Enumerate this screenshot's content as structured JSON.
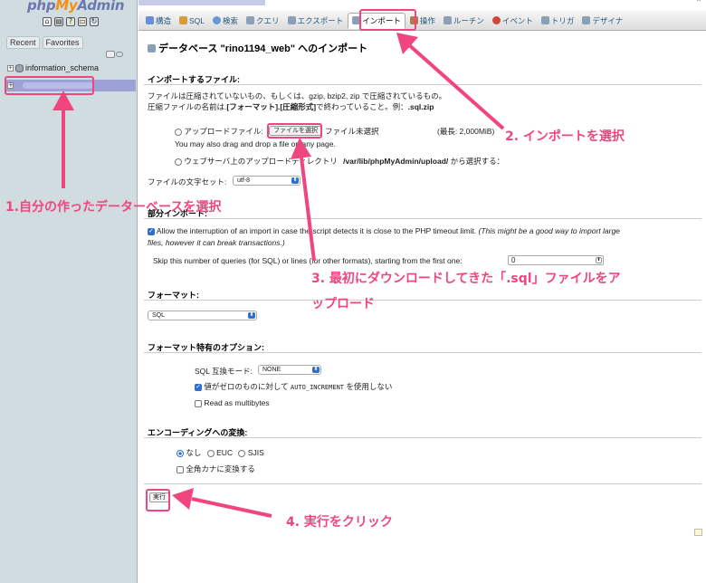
{
  "sidebar": {
    "logo": {
      "php": "php",
      "my": "My",
      "admin": "Admin"
    },
    "quick_icons": [
      "home-icon",
      "exit-icon",
      "docs-icon",
      "sql-window-icon",
      "reload-icon"
    ],
    "tabs": [
      "Recent",
      "Favorites"
    ],
    "tree": {
      "db1": "information_schema",
      "plus": "+"
    }
  },
  "tabs": [
    {
      "label": "構造",
      "icon": "table-icon",
      "color": "#6c8ed8"
    },
    {
      "label": "SQL",
      "icon": "sql-icon",
      "color": "#d89c3a"
    },
    {
      "label": "検索",
      "icon": "search-icon",
      "color": "#5f9ad6"
    },
    {
      "label": "クエリ",
      "icon": "query-icon",
      "color": "#8aa0b8"
    },
    {
      "label": "エクスポート",
      "icon": "export-icon",
      "color": "#8aa0b8"
    },
    {
      "label": "インポート",
      "icon": "import-icon",
      "color": "#8aa0b8"
    },
    {
      "label": "操作",
      "icon": "tools-icon",
      "color": "#b07a4a"
    },
    {
      "label": "ルーチン",
      "icon": "routine-icon",
      "color": "#8aa0b8"
    },
    {
      "label": "イベント",
      "icon": "clock-icon",
      "color": "#d0453a"
    },
    {
      "label": "トリガ",
      "icon": "trigger-icon",
      "color": "#8aa0b8"
    },
    {
      "label": "デザイナ",
      "icon": "designer-icon",
      "color": "#8aa0b8"
    }
  ],
  "main": {
    "title": "データベース \"rino1194_web\" へのインポート",
    "section_file": "インポートするファイル:",
    "compress_note1": "ファイルは圧縮されていないもの、もしくは、gzip, bzip2, zip で圧縮されているもの。",
    "compress_note2a": "圧縮ファイルの名前は.",
    "compress_note2b": "[フォーマット].[圧縮形式]",
    "compress_note2c": "で終わっていること。例：",
    "compress_note2d": ".sql.zip",
    "upload_label": "アップロードファイル:",
    "file_button": "ファイルを選択",
    "file_none": "ファイル未選択",
    "max_size": "(最長: 2,000MiB)",
    "drag_drop": "You may also drag and drop a file on any page.",
    "webserver_label": "ウェブサーバ上のアップロードディレクトリ",
    "webserver_path": "/var/lib/phpMyAdmin/upload/",
    "webserver_suffix": "から選択する：",
    "charset_label": "ファイルの文字セット:",
    "charset_value": "utf-8",
    "section_partial": "部分インポート:",
    "allow_interrupt_a": "Allow the interruption of an import in case the script detects it is close to the PHP timeout limit.",
    "allow_interrupt_b": "(This might be a good way to import large",
    "allow_interrupt_c": "files, however it can break transactions.)",
    "skip_label": "Skip this number of queries (for SQL) or lines (for other formats), starting from the first one:",
    "skip_value": "0",
    "section_format": "フォーマット:",
    "format_value": "SQL",
    "section_format_opts": "フォーマット特有のオプション:",
    "compat_label": "SQL 互換モード:",
    "compat_value": "NONE",
    "auto_inc_a": "値がゼロのものに対して",
    "auto_inc_b": "AUTO_INCREMENT",
    "auto_inc_c": "を使用しない",
    "multibytes": "Read as multibytes",
    "section_encoding": "エンコーディングへの変換:",
    "enc_none": "なし",
    "enc_euc": "EUC",
    "enc_sjis": "SJIS",
    "kana": "全角カナに変換する",
    "exec_button": "実行"
  },
  "annotations": {
    "step1": "1.自分の作ったデーターベースを選択",
    "step2": "2. インポートを選択",
    "step3a": "3. 最初にダウンロードしてきた「.sql」ファイルをア",
    "step3b": "ップロード",
    "step4": "4. 実行をクリック",
    "color": "#f0457d"
  }
}
